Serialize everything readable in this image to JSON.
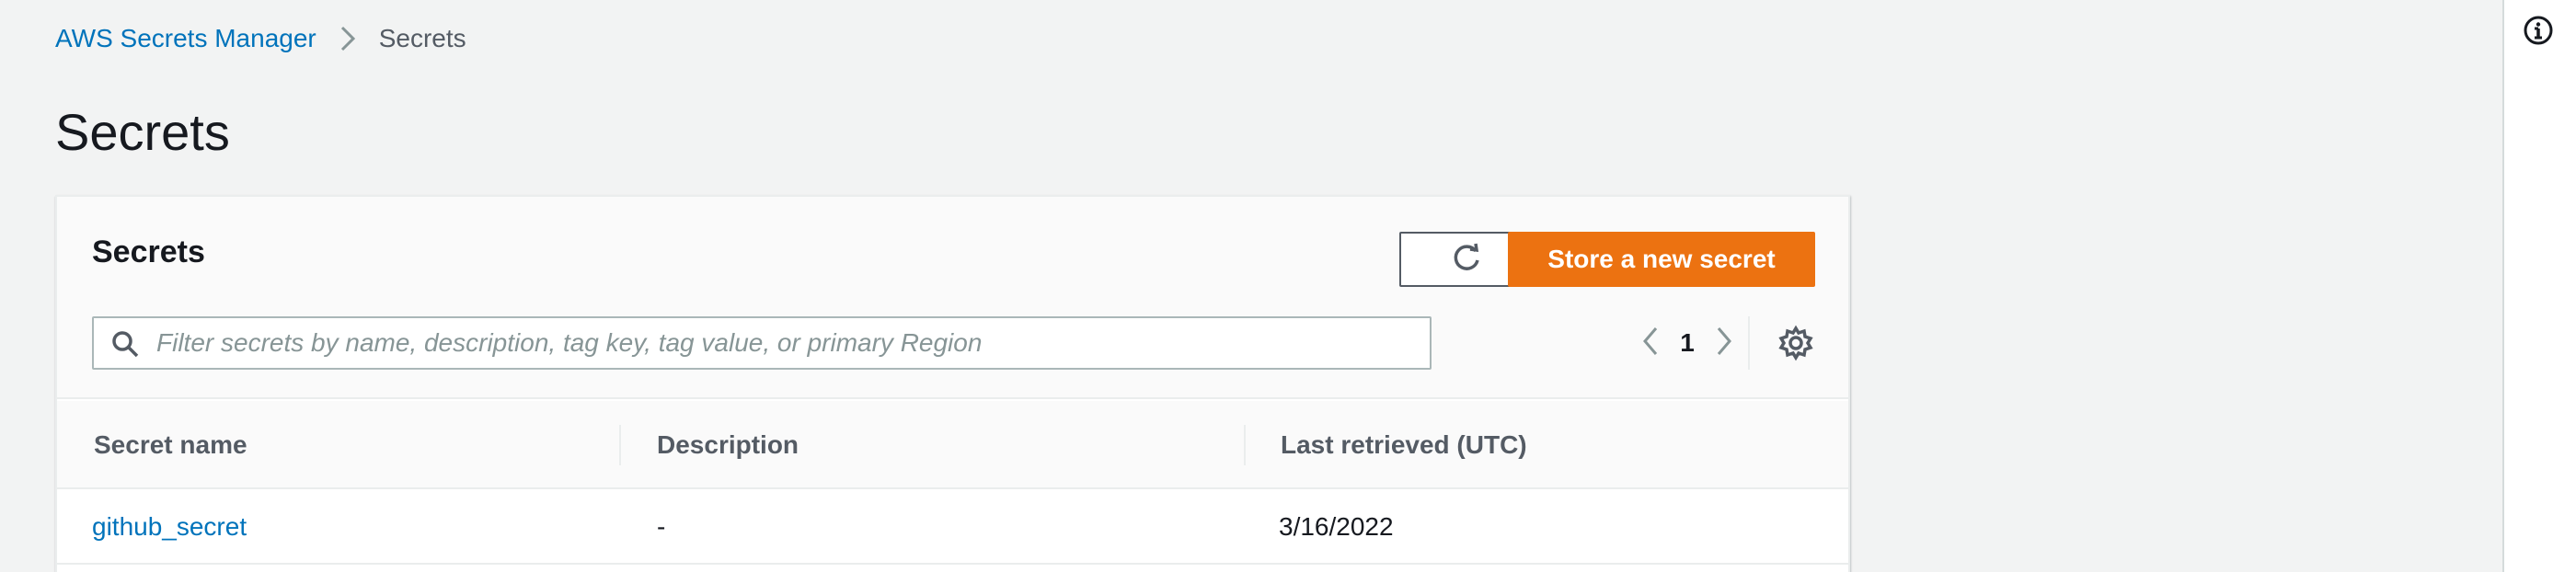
{
  "breadcrumb": {
    "service": "AWS Secrets Manager",
    "current": "Secrets"
  },
  "page": {
    "title": "Secrets"
  },
  "panel": {
    "title": "Secrets",
    "refresh_icon": "refresh-icon",
    "create_button": "Store a new secret",
    "search": {
      "placeholder": "Filter secrets by name, description, tag key, tag value, or primary Region",
      "value": ""
    },
    "pagination": {
      "current_page": "1"
    },
    "settings_icon": "gear-icon"
  },
  "table": {
    "columns": [
      "Secret name",
      "Description",
      "Last retrieved (UTC)"
    ],
    "rows": [
      {
        "name": "github_secret",
        "description": "-",
        "last_retrieved": "3/16/2022"
      }
    ]
  },
  "colors": {
    "primary": "#ec7211",
    "link": "#0073bb",
    "background": "#f2f3f3",
    "text": "#16191f",
    "muted_text": "#545b64"
  }
}
